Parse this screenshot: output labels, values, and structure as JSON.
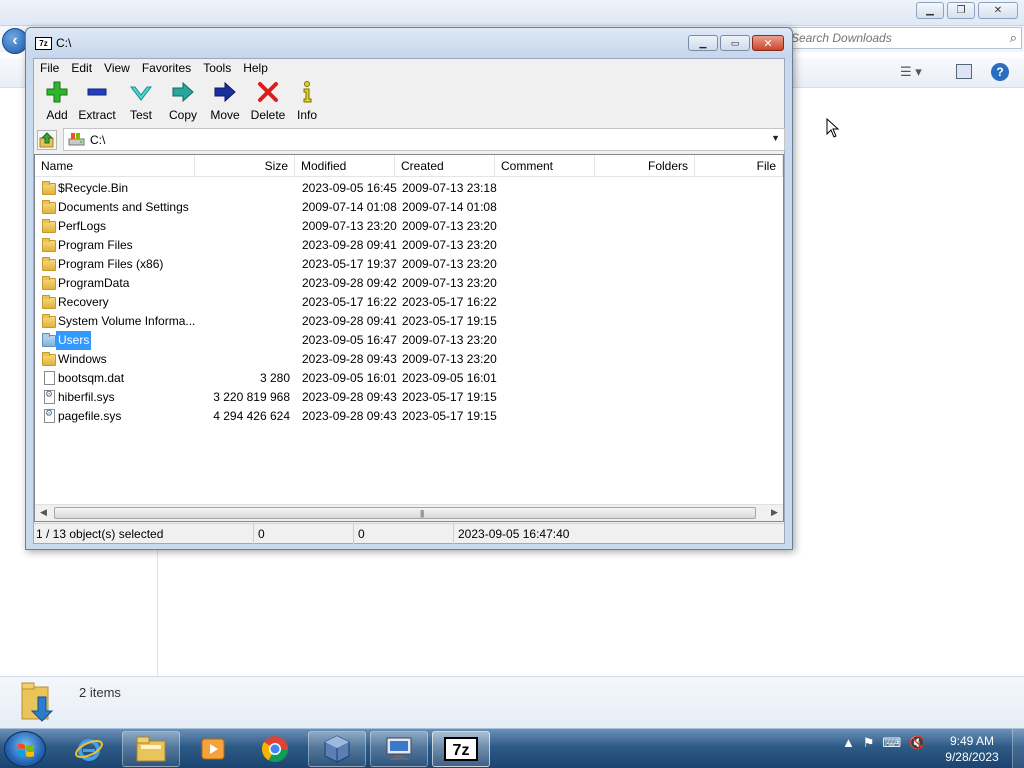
{
  "background_explorer": {
    "search_placeholder": "Search Downloads",
    "status_items": "2 items"
  },
  "sevenzip": {
    "title": "C:\\",
    "menu": [
      "File",
      "Edit",
      "View",
      "Favorites",
      "Tools",
      "Help"
    ],
    "toolbar": {
      "add": "Add",
      "extract": "Extract",
      "test": "Test",
      "copy": "Copy",
      "move": "Move",
      "delete": "Delete",
      "info": "Info"
    },
    "address": "C:\\",
    "columns": {
      "name": "Name",
      "size": "Size",
      "modified": "Modified",
      "created": "Created",
      "comment": "Comment",
      "folders": "Folders",
      "files": "File"
    },
    "rows": [
      {
        "type": "folder",
        "name": "$Recycle.Bin",
        "size": "",
        "modified": "2023-09-05 16:45",
        "created": "2009-07-13 23:18"
      },
      {
        "type": "folder",
        "name": "Documents and Settings",
        "size": "",
        "modified": "2009-07-14 01:08",
        "created": "2009-07-14 01:08"
      },
      {
        "type": "folder",
        "name": "PerfLogs",
        "size": "",
        "modified": "2009-07-13 23:20",
        "created": "2009-07-13 23:20"
      },
      {
        "type": "folder",
        "name": "Program Files",
        "size": "",
        "modified": "2023-09-28 09:41",
        "created": "2009-07-13 23:20"
      },
      {
        "type": "folder",
        "name": "Program Files (x86)",
        "size": "",
        "modified": "2023-05-17 19:37",
        "created": "2009-07-13 23:20"
      },
      {
        "type": "folder",
        "name": "ProgramData",
        "size": "",
        "modified": "2023-09-28 09:42",
        "created": "2009-07-13 23:20"
      },
      {
        "type": "folder",
        "name": "Recovery",
        "size": "",
        "modified": "2023-05-17 16:22",
        "created": "2023-05-17 16:22"
      },
      {
        "type": "folder",
        "name": "System Volume Informa...",
        "size": "",
        "modified": "2023-09-28 09:41",
        "created": "2023-05-17 19:15"
      },
      {
        "type": "folder-user",
        "name": "Users",
        "size": "",
        "modified": "2023-09-05 16:47",
        "created": "2009-07-13 23:20",
        "selected": true
      },
      {
        "type": "folder",
        "name": "Windows",
        "size": "",
        "modified": "2023-09-28 09:43",
        "created": "2009-07-13 23:20"
      },
      {
        "type": "file",
        "name": "bootsqm.dat",
        "size": "3 280",
        "modified": "2023-09-05 16:01",
        "created": "2023-09-05 16:01"
      },
      {
        "type": "sysfile",
        "name": "hiberfil.sys",
        "size": "3 220 819 968",
        "modified": "2023-09-28 09:43",
        "created": "2023-05-17 19:15"
      },
      {
        "type": "sysfile",
        "name": "pagefile.sys",
        "size": "4 294 426 624",
        "modified": "2023-09-28 09:43",
        "created": "2023-05-17 19:15"
      }
    ],
    "status": {
      "selection": "1 / 13 object(s) selected",
      "size": "0",
      "packed": "0",
      "date": "2023-09-05 16:47:40"
    }
  },
  "taskbar": {
    "time": "9:49 AM",
    "date": "9/28/2023"
  },
  "colors": {
    "selection": "#3399ff",
    "taskbar": "#2e5a86"
  }
}
